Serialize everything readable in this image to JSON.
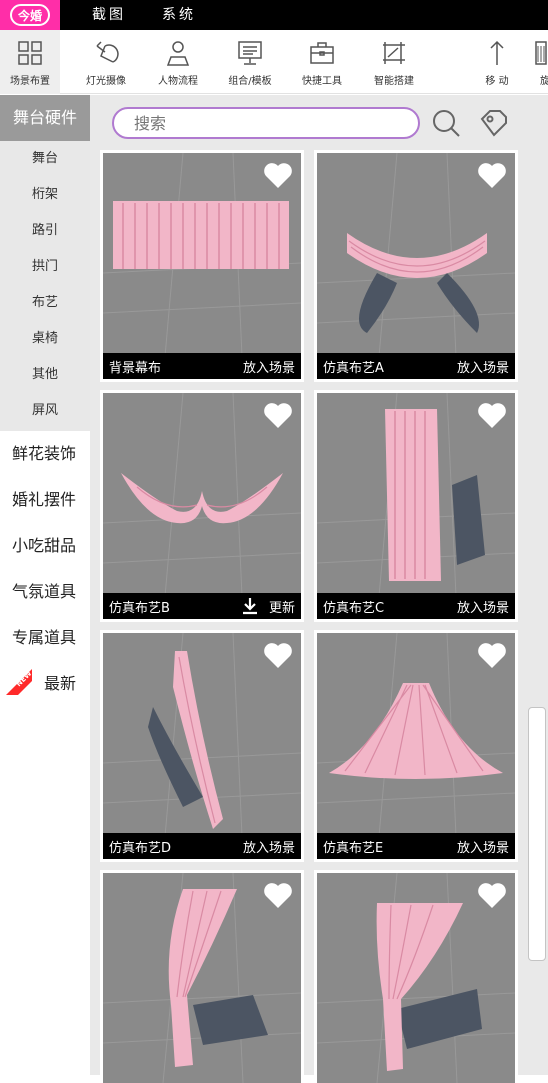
{
  "app": {
    "logo_text": "今婚"
  },
  "menubar": {
    "items": [
      "截图",
      "系统"
    ]
  },
  "toolbar": {
    "tools": [
      {
        "label": "场景布置",
        "icon": "grid-icon"
      },
      {
        "label": "灯光摄像",
        "icon": "spotlight-icon"
      },
      {
        "label": "人物流程",
        "icon": "person-icon"
      },
      {
        "label": "组合/模板",
        "icon": "monitor-icon"
      },
      {
        "label": "快捷工具",
        "icon": "briefcase-icon"
      },
      {
        "label": "智能搭建",
        "icon": "frame-icon"
      },
      {
        "label": "移 动",
        "icon": "arrow-up-icon"
      },
      {
        "label": "旋",
        "icon": "rotate-icon"
      }
    ]
  },
  "sidebar": {
    "header": "舞台硬件",
    "sub_items": [
      "舞台",
      "桁架",
      "路引",
      "拱门",
      "布艺",
      "桌椅",
      "其他",
      "屏风"
    ],
    "categories": [
      "鲜花装饰",
      "婚礼摆件",
      "小吃甜品",
      "气氛道具",
      "专属道具"
    ],
    "newest": {
      "badge": "NEW",
      "label": "最新"
    }
  },
  "search": {
    "placeholder": "搜索"
  },
  "cards": [
    {
      "name": "背景幕布",
      "action": "放入场景"
    },
    {
      "name": "仿真布艺A",
      "action": "放入场景"
    },
    {
      "name": "仿真布艺B",
      "action": "更新"
    },
    {
      "name": "仿真布艺C",
      "action": "放入场景"
    },
    {
      "name": "仿真布艺D",
      "action": "放入场景"
    },
    {
      "name": "仿真布艺E",
      "action": "放入场景"
    }
  ],
  "colors": {
    "accent": "#ff2ea8",
    "search_border": "#b07ad0",
    "fabric": "#f2b6c8",
    "card_bg": "#8a8a8a"
  }
}
